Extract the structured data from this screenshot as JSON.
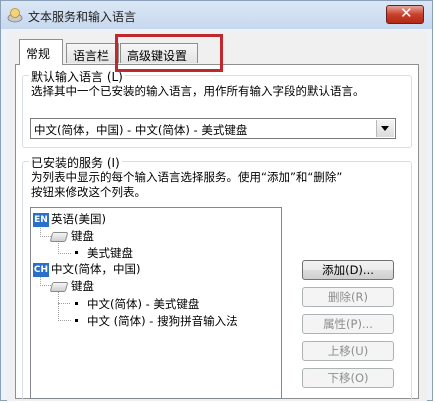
{
  "window": {
    "title": "文本服务和输入语言",
    "close_symbol": "✕"
  },
  "tabs": [
    {
      "label": "常规",
      "active": true
    },
    {
      "label": "语言栏",
      "active": false
    },
    {
      "label": "高级键设置",
      "active": false,
      "highlighted": true
    }
  ],
  "default_language": {
    "group_label": "默认输入语言 (L)",
    "description": "选择其中一个已安装的输入语言，用作所有输入字段的默认语言。",
    "selected": "中文(简体，中国) - 中文(简体) - 美式键盘"
  },
  "services": {
    "group_label": "已安装的服务 (I)",
    "description_line1": "为列表中显示的每个输入语言选择服务。使用“添加”和“删除”",
    "description_line2": "按钮来修改这个列表。",
    "tree": {
      "lang1": {
        "badge": "EN",
        "label": "英语(美国)",
        "keyboard": "键盘",
        "item": "美式键盘"
      },
      "lang2": {
        "badge": "CH",
        "label": "中文(简体，中国)",
        "keyboard": "键盘",
        "item1": "中文(简体) - 美式键盘",
        "item2": "中文 (简体) - 搜狗拼音输入法"
      }
    },
    "buttons": {
      "add": "添加(D)...",
      "remove": "删除(R)",
      "properties": "属性(P)...",
      "move_up": "上移(U)",
      "move_down": "下移(O)"
    }
  },
  "colors": {
    "highlight_box": "#c0282d",
    "lang_badge": "#2a6fc9"
  }
}
